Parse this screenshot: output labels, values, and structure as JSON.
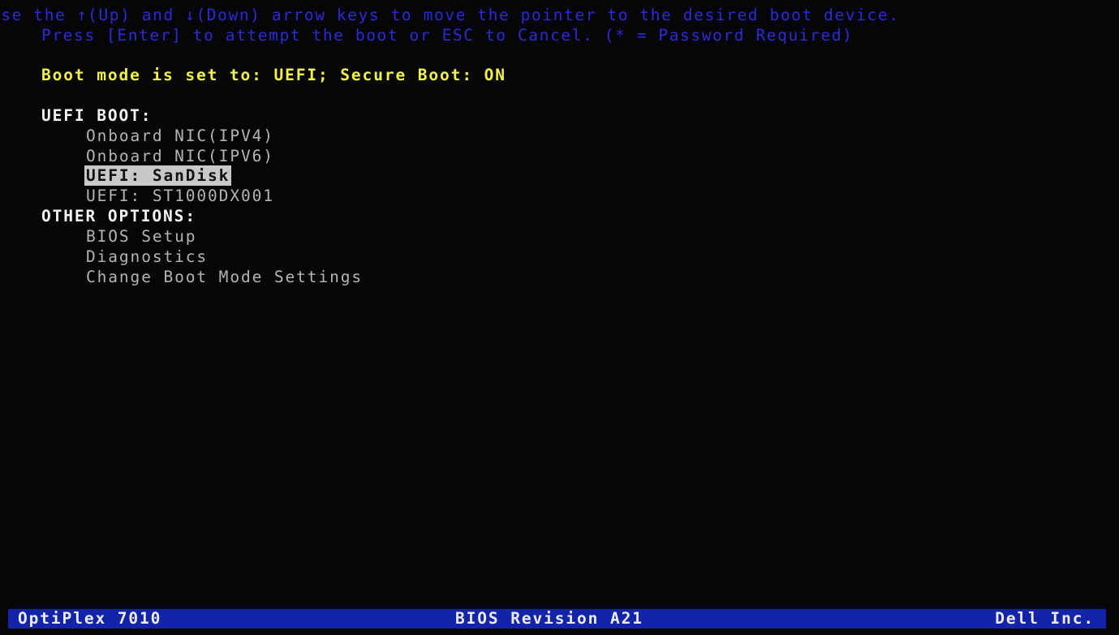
{
  "instructions": {
    "line1": "Use the ↑(Up) and ↓(Down) arrow keys to move the pointer to the desired boot device.",
    "line2": "Press [Enter] to attempt the boot or ESC to Cancel. (* = Password Required)"
  },
  "boot_mode_text": "Boot mode is set to: UEFI; Secure Boot: ON",
  "uefi_boot": {
    "header": "UEFI BOOT:",
    "items": [
      {
        "label": "Onboard NIC(IPV4)",
        "selected": false
      },
      {
        "label": "Onboard NIC(IPV6)",
        "selected": false
      },
      {
        "label": "UEFI: SanDisk",
        "selected": true
      },
      {
        "label": "UEFI: ST1000DX001",
        "selected": false
      }
    ]
  },
  "other_options": {
    "header": "OTHER OPTIONS:",
    "items": [
      {
        "label": "BIOS Setup"
      },
      {
        "label": "Diagnostics"
      },
      {
        "label": "Change Boot Mode Settings"
      }
    ]
  },
  "footer": {
    "model": "OptiPlex 7010",
    "bios_revision": "BIOS Revision A21",
    "vendor": "Dell Inc."
  },
  "colors": {
    "background": "#060606",
    "instructions": "#2b2bd8",
    "boot_mode": "#f2f24c",
    "highlight": "#c8c8c8",
    "footer_bar": "#1424a8"
  }
}
